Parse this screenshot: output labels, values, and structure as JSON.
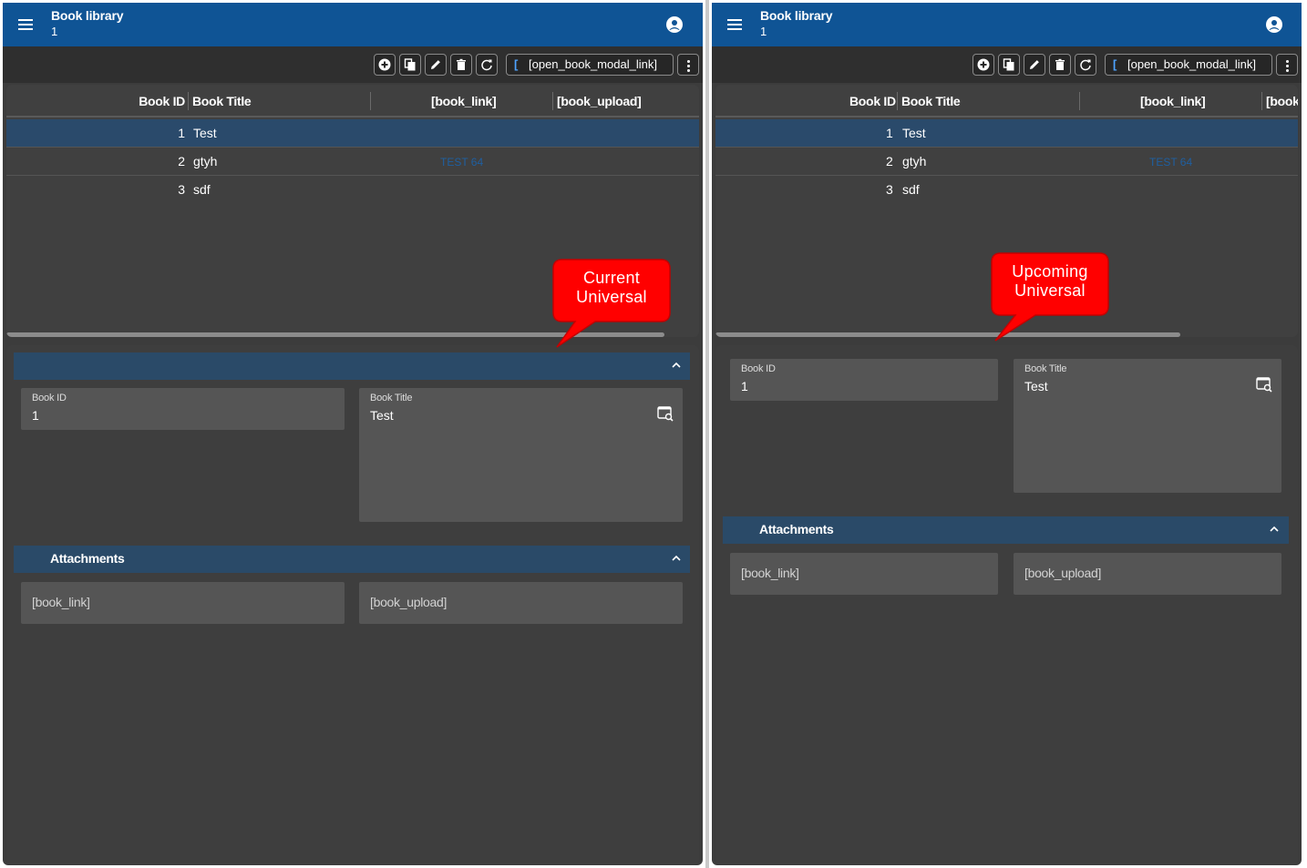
{
  "app": {
    "title": "Book library",
    "subtitle": "1"
  },
  "toolbar": {
    "buttons": [
      "add-icon",
      "copy-icon",
      "edit-icon",
      "delete-icon",
      "refresh-icon"
    ],
    "open_modal_label": "[open_book_modal_link]",
    "bracket_glyph": "["
  },
  "grid": {
    "columns": [
      "Book ID",
      "Book Title",
      "[book_link]",
      "[book_upload]"
    ],
    "columns_right_truncated": [
      "Book ID",
      "Book Title",
      "[book_link]",
      "[book"
    ],
    "rows": [
      {
        "id": "1",
        "title": "Test",
        "link": ""
      },
      {
        "id": "2",
        "title": "gtyh",
        "link": "TEST 64"
      },
      {
        "id": "3",
        "title": "sdf",
        "link": ""
      }
    ]
  },
  "form": {
    "book_id_label": "Book ID",
    "book_id_value": "1",
    "book_title_label": "Book Title",
    "book_title_value": "Test",
    "attachments_label": "Attachments",
    "book_link_placeholder": "[book_link]",
    "book_upload_placeholder": "[book_upload]"
  },
  "callouts": {
    "left": [
      "Current",
      "Universal"
    ],
    "right": [
      "Upcoming",
      "Universal"
    ]
  },
  "colors": {
    "appbar": "#0f5495",
    "section_header": "#2a4a68",
    "selected_row": "#2a4a6b",
    "callout": "#ff0000"
  }
}
